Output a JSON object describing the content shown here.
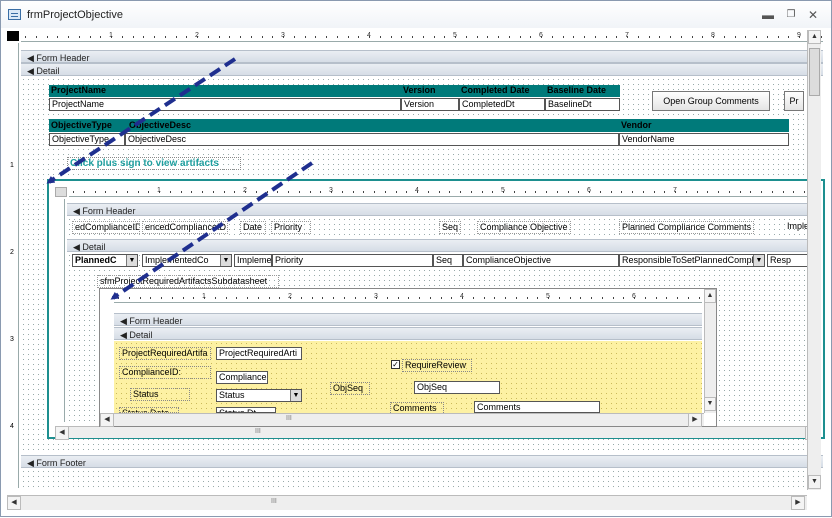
{
  "window": {
    "title": "frmProjectObjective"
  },
  "main": {
    "form_header": "Form Header",
    "detail": "Detail",
    "form_footer": "Form Footer",
    "project_name_label": "ProjectName",
    "version_label": "Version",
    "completed_date_label": "Completed Date",
    "baseline_date_label": "Baseline Date",
    "project_name_field": "ProjectName",
    "version_field": "Version",
    "completed_field": "CompletedDt",
    "baseline_field": "BaselineDt",
    "open_group_comments": "Open Group Comments",
    "pr_button": "Pr",
    "objective_type_label": "ObjectiveType",
    "objective_desc_label": "ObjectiveDesc",
    "vendor_label": "Vendor",
    "objective_type_field": "ObjectiveType",
    "objective_desc_field": "ObjectiveDesc",
    "vendor_field": "VendorName",
    "click_plus_text": "Click plus sign to view artifacts"
  },
  "sub1": {
    "form_header": "Form Header",
    "detail": "Detail",
    "header_labels": [
      "edComplianceID",
      "encedComplianceID",
      "Date",
      "Priority",
      "Seq",
      "Compliance Objective",
      "Planned Compliance Comments",
      "Imple"
    ],
    "detail_fields": [
      "PlannedC",
      "ImplementedCo",
      "Implemer",
      "Priority",
      "Seq",
      "ComplianceObjective",
      "ResponsibleToSetPlannedComplia",
      "Resp"
    ],
    "subdatasheet_label": "sfmProjectRequiredArtifactsSubdatasheet"
  },
  "sub2": {
    "form_header": "Form Header",
    "detail": "Detail",
    "req_artifact_label": "ProjectRequiredArtifa",
    "req_artifact_field": "ProjectRequiredArti",
    "compliance_id_label": "ComplianceID:",
    "compliance_field": "Compliance",
    "status_label": "Status",
    "status_field": "Status",
    "status_date_label": "Status Date",
    "status_date_field": "Status Dt",
    "require_review": "RequireReview",
    "objseq_label": "ObjSeq",
    "objseq_field": "ObjSeq",
    "comments_label": "Comments",
    "comments_field": "Comments"
  },
  "ruler": {
    "main": [
      "1",
      "2",
      "3",
      "4",
      "5",
      "6",
      "7",
      "8",
      "9"
    ],
    "sub1": [
      "1",
      "2",
      "3",
      "4",
      "5",
      "6",
      "7"
    ],
    "sub2": [
      "1",
      "2",
      "3",
      "4",
      "5",
      "6"
    ],
    "vertical": [
      "1",
      "2",
      "3",
      "4"
    ]
  },
  "hscroll_label": "III",
  "colors": {
    "teal": "#007a7a",
    "sub_border": "#1d8f8f",
    "arrow": "#1f2f8f",
    "yellow": "#fdf1a3"
  }
}
